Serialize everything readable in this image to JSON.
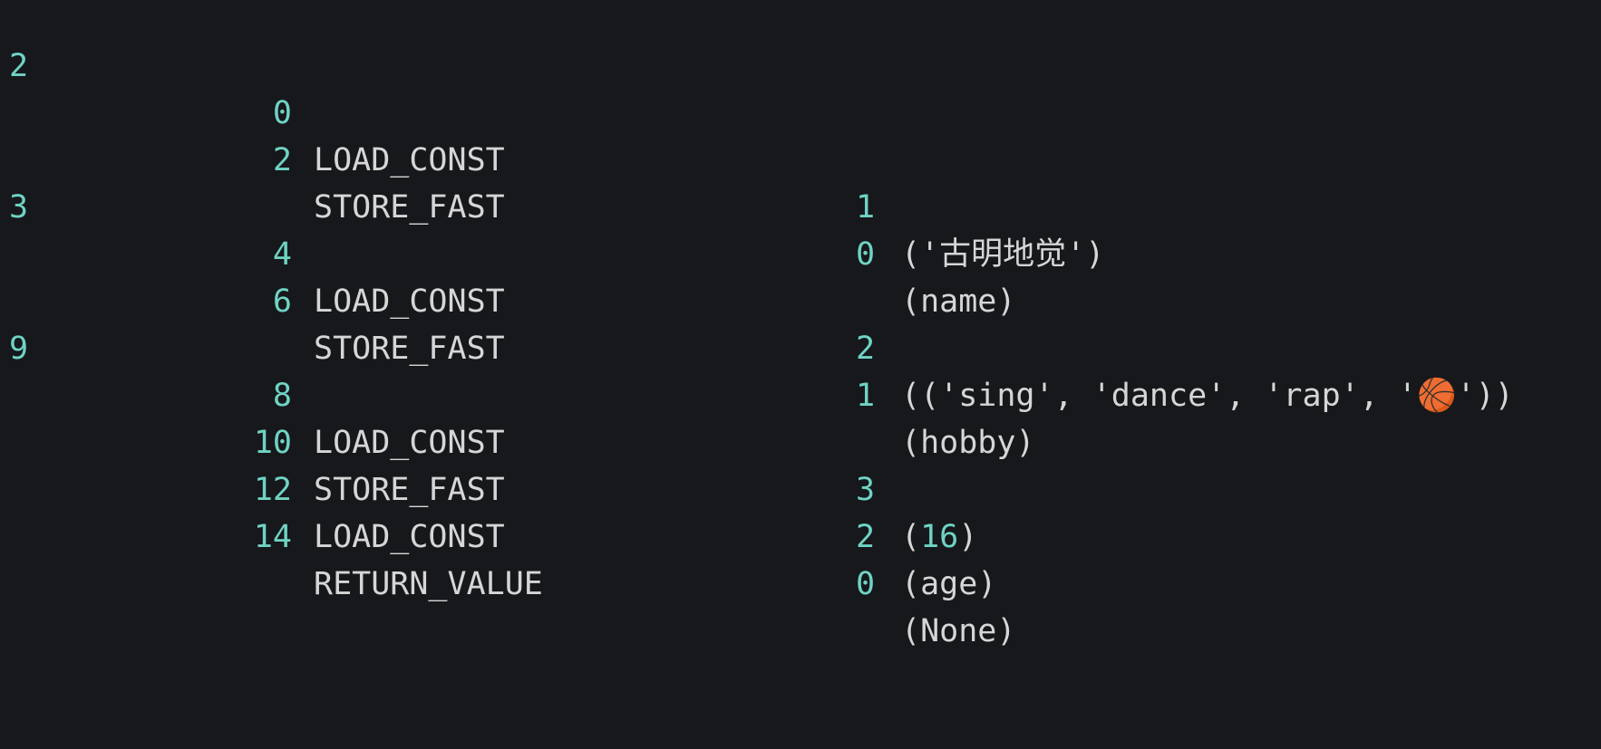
{
  "window": {
    "background": "#16181b",
    "accent_color": "#6fd3c4",
    "text_color": "#d6d6d6"
  },
  "disassembly": [
    {
      "line": "2",
      "offset": "0",
      "opname": "LOAD_CONST",
      "arg": "1",
      "argrepr": "('古明地觉')"
    },
    {
      "line": "",
      "offset": "2",
      "opname": "STORE_FAST",
      "arg": "0",
      "argrepr": "(name)"
    },
    {
      "line": "3",
      "offset": "4",
      "opname": "LOAD_CONST",
      "arg": "2",
      "argrepr": "(('sing', 'dance', 'rap', '🏀'))"
    },
    {
      "line": "",
      "offset": "6",
      "opname": "STORE_FAST",
      "arg": "1",
      "argrepr": "(hobby)"
    },
    {
      "line": "9",
      "offset": "8",
      "opname": "LOAD_CONST",
      "arg": "3",
      "argrepr_prefix": "(",
      "argrepr_number": "16",
      "argrepr_suffix": ")"
    },
    {
      "line": "",
      "offset": "10",
      "opname": "STORE_FAST",
      "arg": "2",
      "argrepr": "(age)"
    },
    {
      "line": "",
      "offset": "12",
      "opname": "LOAD_CONST",
      "arg": "0",
      "argrepr": "(None)"
    },
    {
      "line": "",
      "offset": "14",
      "opname": "RETURN_VALUE",
      "arg": "",
      "argrepr": ""
    }
  ]
}
